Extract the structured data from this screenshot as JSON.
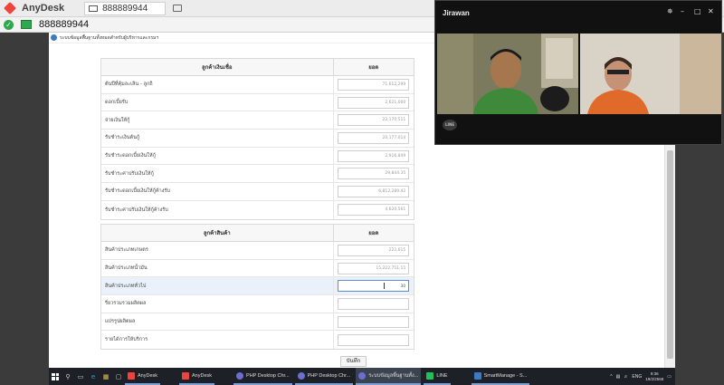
{
  "anydesk": {
    "brand": "AnyDesk",
    "tab_id": "888889944",
    "remote_id": "888889944",
    "check": "✓"
  },
  "page": {
    "header_title": "ระบบข้อมูลพื้นฐานทั้งหมดสำหรับผู้บริหารและกรมฯ",
    "tables": [
      {
        "header_label": "ลูกค้าเงินเชื่อ",
        "header_value": "ยอด",
        "rows": [
          {
            "label": "ต้นปีที่คุ้มละเลิน - ลูกถิ",
            "value": "71,612,299"
          },
          {
            "label": "ดอกเบี้ยรับ",
            "value": "2,621,000"
          },
          {
            "label": "จ่ายเงินให้กู้",
            "value": "22,170,511"
          },
          {
            "label": "รับชำระเงินต้นกู้",
            "value": "20,177,014"
          },
          {
            "label": "รับชำระดอกเบี้ยเงินให้กู้",
            "value": "2,916,849"
          },
          {
            "label": "รับชำระค่าปรับเงินให้กู้",
            "value": "29,844.35"
          },
          {
            "label": "รับชำระดอกเบี้ยเงินให้กู้ค้างรับ",
            "value": "6,812,289.42"
          },
          {
            "label": "รับชำระค่าปรับเงินให้กู้ค้างรับ",
            "value": "4,620,561"
          }
        ]
      },
      {
        "header_label": "ลูกค้าสินค้า",
        "header_value": "ยอด",
        "rows": [
          {
            "label": "สินค้าประเภทเกษตร",
            "value": "222,615"
          },
          {
            "label": "สินค้าประเภทน้ำมัน",
            "value": "15,222,751.15"
          },
          {
            "label": "สินค้าประเภททั่วไป",
            "value": "30"
          },
          {
            "label": "รี่ยวรวมรวมผลิตผล",
            "value": ""
          },
          {
            "label": "แปรรูปผลิตผล",
            "value": ""
          },
          {
            "label": "รายได้การให้บริการ",
            "value": ""
          }
        ]
      }
    ],
    "save_label": "บันทึก"
  },
  "taskbar": {
    "apps": [
      {
        "label": "AnyDesk",
        "color": "#ef443b"
      },
      {
        "label": "AnyDesk",
        "color": "#ef443b"
      },
      {
        "label": "PHP Desktop Chr...",
        "color": "#6a6fd0"
      },
      {
        "label": "PHP Desktop Chr...",
        "color": "#6a6fd0"
      },
      {
        "label": "ระบบข้อมูลพื้นฐานทั้ง...",
        "color": "#6a6fd0"
      },
      {
        "label": "LINE",
        "color": "#20c05b"
      },
      {
        "label": "SmartManage - S...",
        "color": "#3c7bc4"
      }
    ],
    "lang": "ENG",
    "time": "9:36",
    "date": "19/2/2568"
  },
  "call": {
    "caller": "Jirawan",
    "app_logo": "LINE"
  }
}
